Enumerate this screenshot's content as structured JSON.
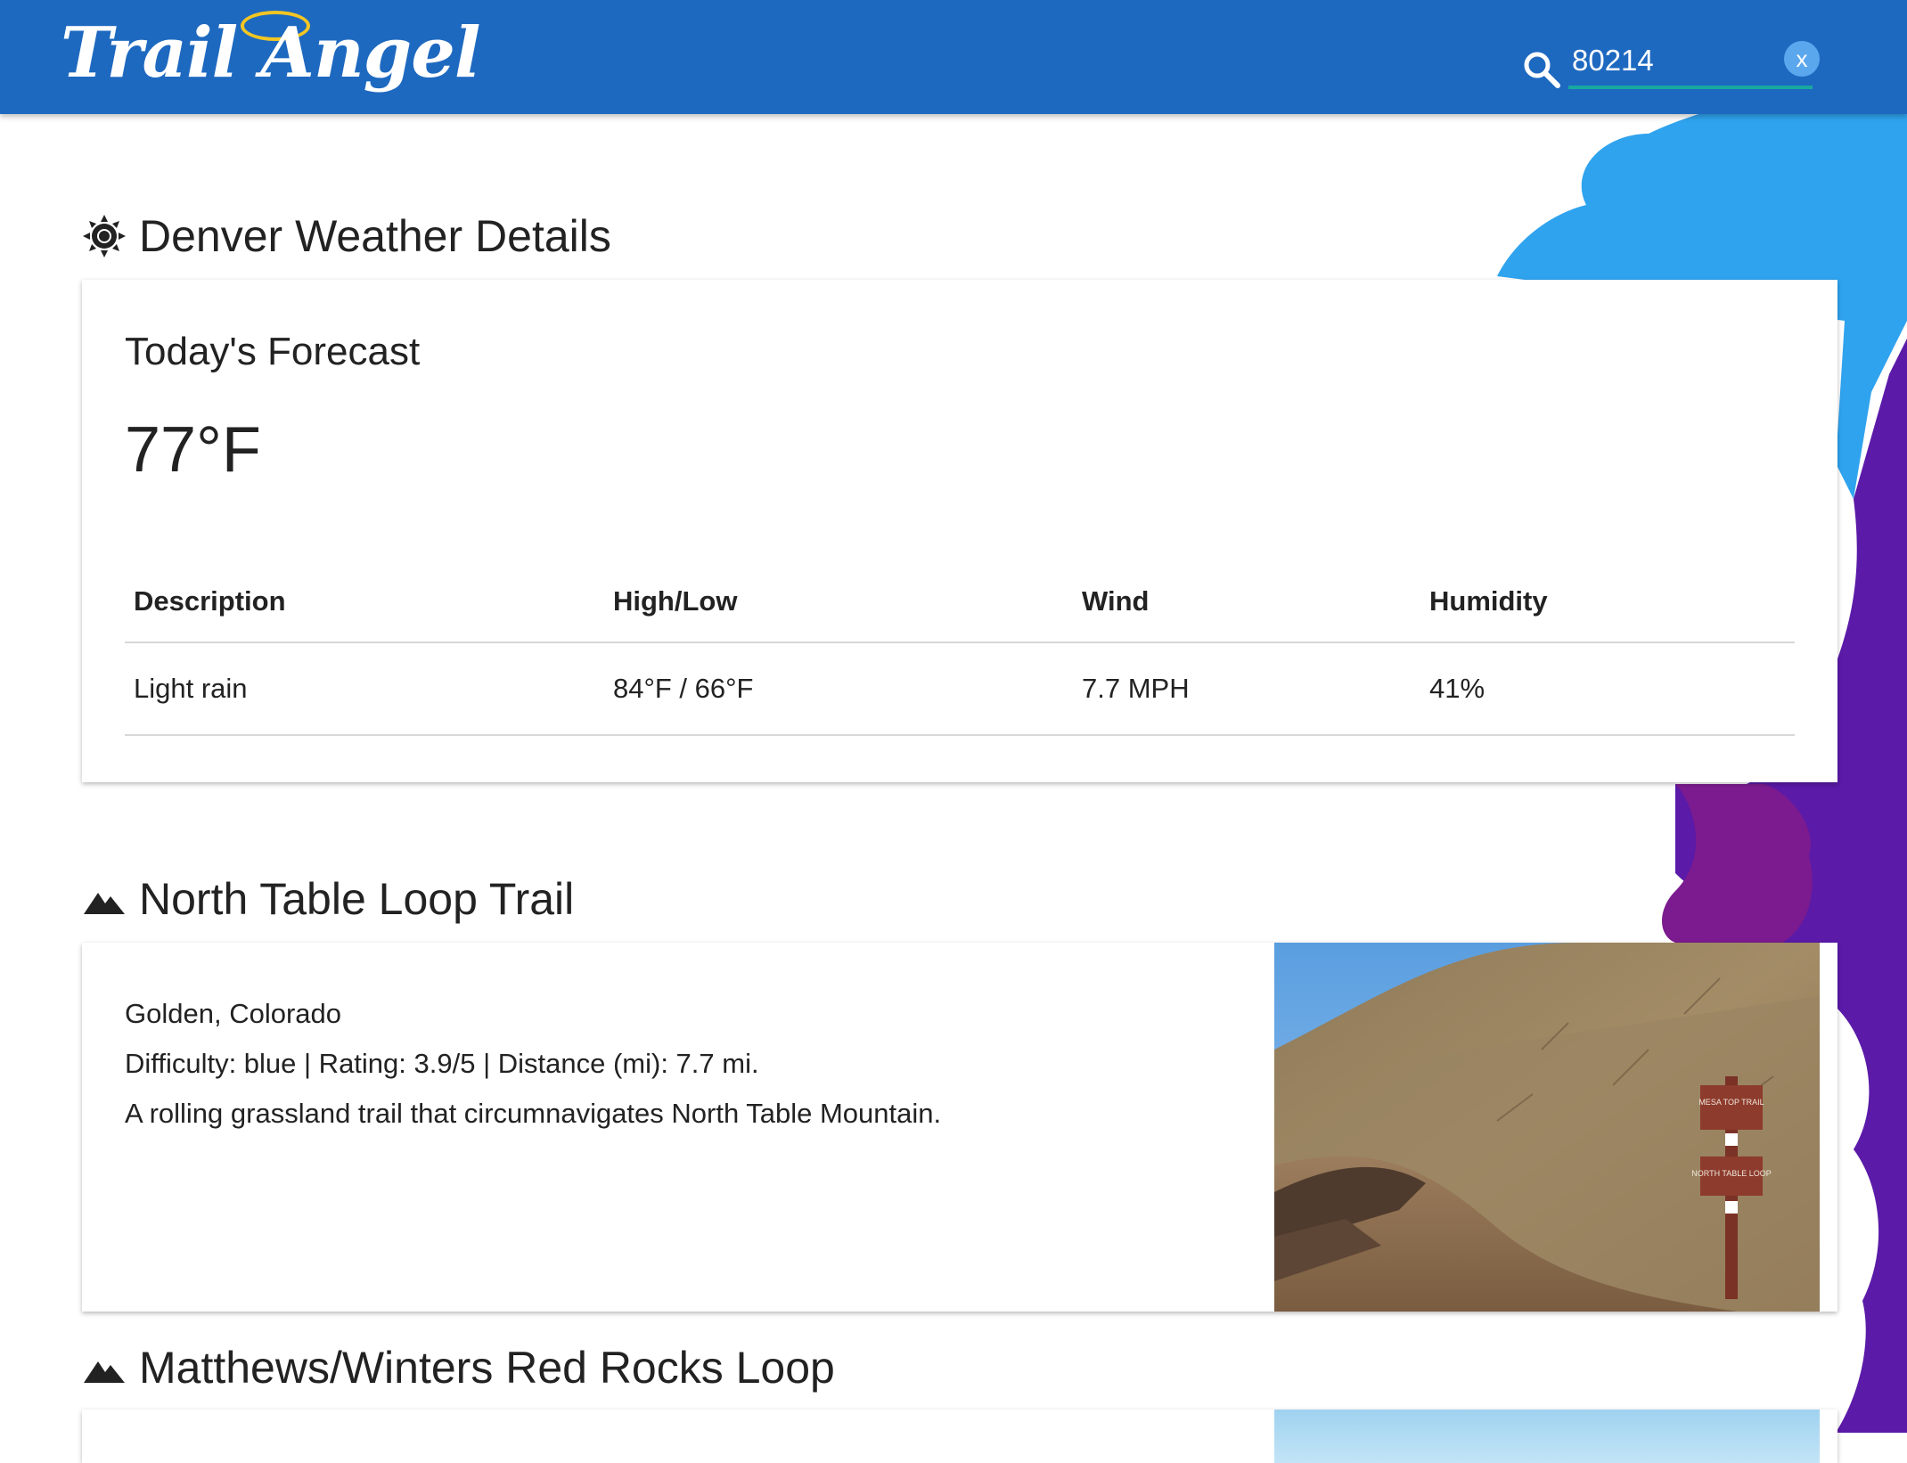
{
  "app": {
    "logo_text": "Trail Angel"
  },
  "header": {
    "search_value": "80214",
    "clear_label": "x"
  },
  "weather": {
    "heading": "Denver Weather Details",
    "forecast_title": "Today's Forecast",
    "temperature": "77°F",
    "table": {
      "headers": [
        "Description",
        "High/Low",
        "Wind",
        "Humidity"
      ],
      "row": [
        "Light rain",
        "84°F / 66°F",
        "7.7 MPH",
        "41%"
      ]
    }
  },
  "trails": [
    {
      "heading": "North Table Loop Trail",
      "location": "Golden, Colorado",
      "stats": "Difficulty: blue | Rating: 3.9/5 | Distance (mi): 7.7 mi.",
      "description": "A rolling grassland trail that circumnavigates North Table Mountain.",
      "sign_text_1": "MESA TOP TRAIL",
      "sign_text_2": "NORTH TABLE LOOP"
    },
    {
      "heading": "Matthews/Winters Red Rocks Loop"
    }
  ],
  "colors": {
    "header_bg": "#1e69c0",
    "search_underline": "#17a8a0",
    "bg_blue": "#2fa3ee",
    "bg_purple": "#5b1aa8",
    "bg_magenta": "#7b1b8f"
  },
  "icons": {
    "search": "search-icon",
    "clear": "close-icon",
    "weather": "sun-icon",
    "trail": "mountain-icon"
  }
}
